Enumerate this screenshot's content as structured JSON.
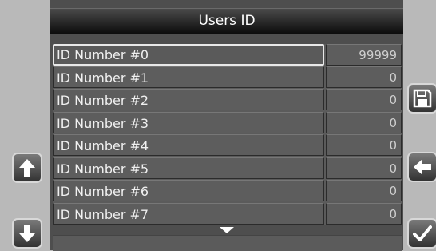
{
  "title": "Users ID",
  "rows": [
    {
      "label": "ID Number #0",
      "value": "99999",
      "selected": true
    },
    {
      "label": "ID Number #1",
      "value": "0"
    },
    {
      "label": "ID Number #2",
      "value": "0"
    },
    {
      "label": "ID Number #3",
      "value": "0"
    },
    {
      "label": "ID Number #4",
      "value": "0"
    },
    {
      "label": "ID Number #5",
      "value": "0"
    },
    {
      "label": "ID Number #6",
      "value": "0"
    },
    {
      "label": "ID Number #7",
      "value": "0"
    }
  ],
  "icons": {
    "up": "arrow-up-icon",
    "down": "arrow-down-icon",
    "save": "floppy-disk-icon",
    "back": "arrow-left-icon",
    "confirm": "checkmark-icon",
    "scroll": "chevron-down-icon"
  }
}
